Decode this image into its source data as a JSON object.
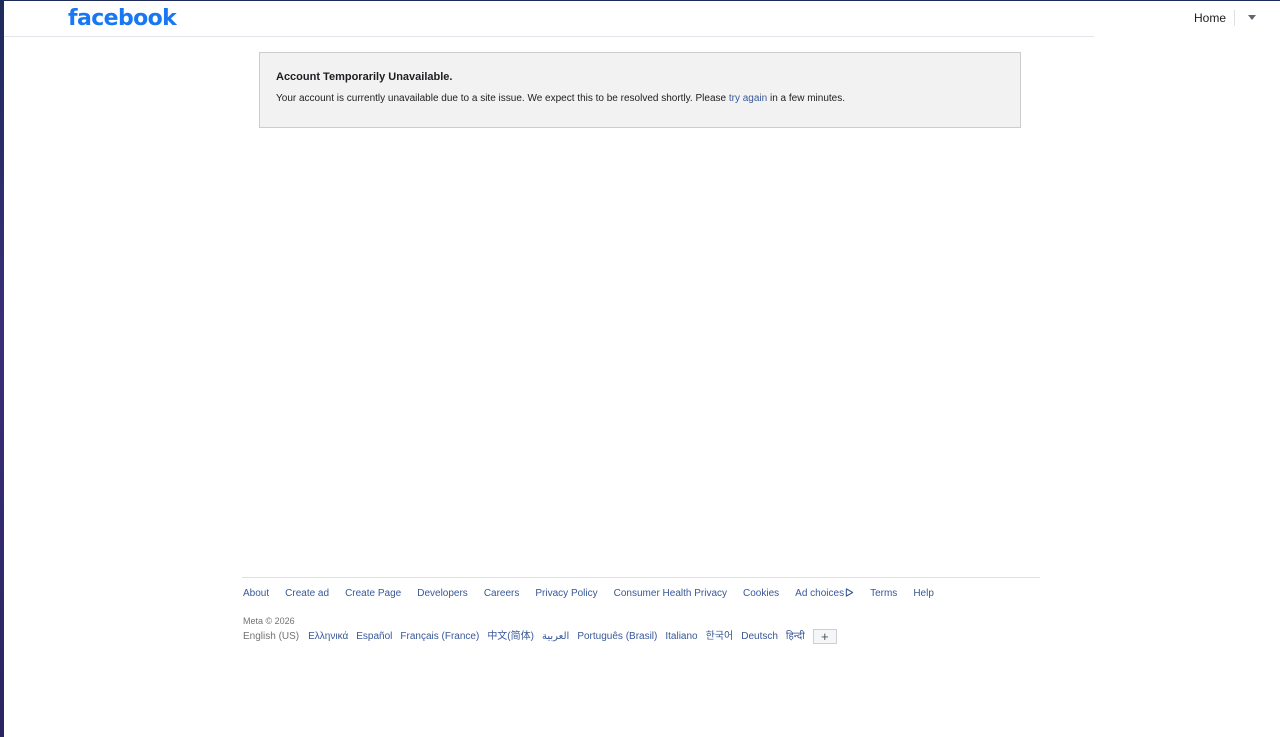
{
  "header": {
    "logo_text": "facebook",
    "home_label": "Home",
    "menu_icon": "caret-down-icon"
  },
  "notice": {
    "title": "Account Temporarily Unavailable.",
    "body_before": "Your account is currently unavailable due to a site issue. We expect this to be resolved shortly. Please ",
    "link_text": "try again",
    "body_after": " in a few minutes."
  },
  "footer": {
    "links": [
      "About",
      "Create ad",
      "Create Page",
      "Developers",
      "Careers",
      "Privacy Policy",
      "Consumer Health Privacy",
      "Cookies",
      "Ad choices",
      "Terms",
      "Help"
    ],
    "copyright": "Meta © 2026",
    "current_language": "English (US)",
    "languages": [
      "Ελληνικά",
      "Español",
      "Français (France)",
      "中文(简体)",
      "العربية",
      "Português (Brasil)",
      "Italiano",
      "한국어",
      "Deutsch",
      "हिन्दी"
    ],
    "more_languages_label": "+"
  },
  "colors": {
    "brand": "#1877f2",
    "link": "#385898",
    "notice_bg": "#f2f2f2",
    "notice_border": "#cccccc"
  }
}
